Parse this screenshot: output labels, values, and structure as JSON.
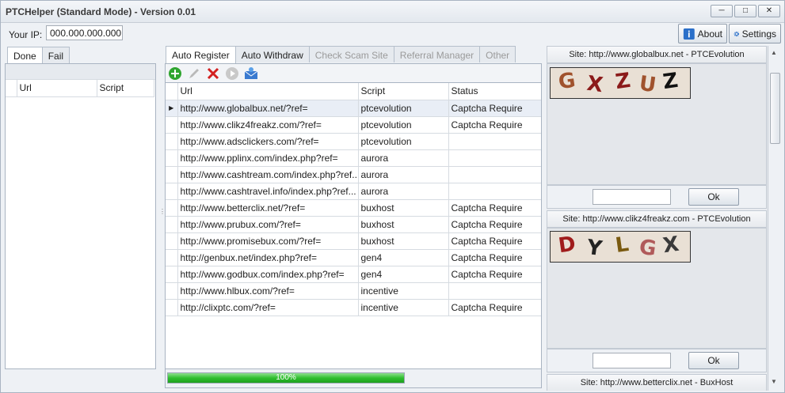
{
  "window": {
    "title": "PTCHelper (Standard Mode) - Version 0.01"
  },
  "header": {
    "ip_label": "Your IP:",
    "ip_value": "000.000.000.000",
    "about_label": "About",
    "settings_label": "Settings"
  },
  "left": {
    "tabs": [
      "Done",
      "Fail"
    ],
    "columns": [
      "Url",
      "Script"
    ]
  },
  "center": {
    "tabs": [
      "Auto Register",
      "Auto Withdraw",
      "Check Scam Site",
      "Referral Manager",
      "Other"
    ],
    "columns": [
      "Url",
      "Script",
      "Status"
    ],
    "rows": [
      {
        "url": "http://www.globalbux.net/?ref=",
        "script": "ptcevolution",
        "status": "Captcha Require"
      },
      {
        "url": "http://www.clikz4freakz.com/?ref=",
        "script": "ptcevolution",
        "status": "Captcha Require"
      },
      {
        "url": "http://www.adsclickers.com/?ref=",
        "script": "ptcevolution",
        "status": ""
      },
      {
        "url": "http://www.pplinx.com/index.php?ref=",
        "script": "aurora",
        "status": ""
      },
      {
        "url": "http://www.cashtream.com/index.php?ref...",
        "script": "aurora",
        "status": ""
      },
      {
        "url": "http://www.cashtravel.info/index.php?ref...",
        "script": "aurora",
        "status": ""
      },
      {
        "url": "http://www.betterclix.net/?ref=",
        "script": "buxhost",
        "status": "Captcha Require"
      },
      {
        "url": "http://www.prubux.com/?ref=",
        "script": "buxhost",
        "status": "Captcha Require"
      },
      {
        "url": "http://www.promisebux.com/?ref=",
        "script": "buxhost",
        "status": "Captcha Require"
      },
      {
        "url": "http://genbux.net/index.php?ref=",
        "script": "gen4",
        "status": "Captcha Require"
      },
      {
        "url": "http://www.godbux.com/index.php?ref=",
        "script": "gen4",
        "status": "Captcha Require"
      },
      {
        "url": "http://www.hlbux.com/?ref=",
        "script": "incentive",
        "status": ""
      },
      {
        "url": "http://clixptc.com/?ref=",
        "script": "incentive",
        "status": "Captcha Require"
      }
    ],
    "progress": {
      "value": 1.0,
      "label": "100%"
    }
  },
  "right": {
    "captchas": [
      {
        "site": "Site: http://www.globalbux.net - PTCEvolution",
        "chars": [
          "G",
          "X",
          "Z",
          "U",
          "Z"
        ],
        "colors": [
          "#a0522d",
          "#8b1a1a",
          "#8b1a1a",
          "#a0522d",
          "#111111"
        ],
        "ok": "Ok"
      },
      {
        "site": "Site: http://www.clikz4freakz.com - PTCEvolution",
        "chars": [
          "D",
          "Y",
          "L",
          "G",
          "X"
        ],
        "colors": [
          "#a01c1c",
          "#222222",
          "#7a5a10",
          "#b05a5a",
          "#3a3a3a"
        ],
        "ok": "Ok"
      }
    ],
    "partial_site": "Site: http://www.betterclix.net - BuxHost"
  }
}
